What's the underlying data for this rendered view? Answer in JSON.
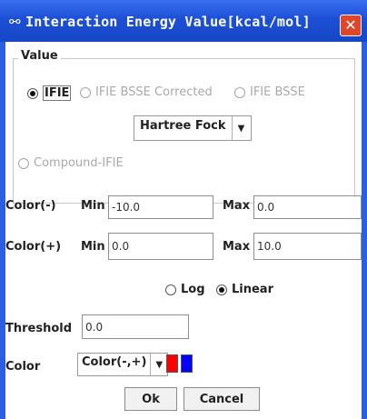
{
  "window": {
    "title": "Interaction Energy Value[kcal/mol]",
    "title_icon": "molecule-icon",
    "close_symbol": "✕"
  },
  "value_group": {
    "legend": "Value",
    "options": [
      {
        "label": "IFIE",
        "selected": true,
        "enabled": true
      },
      {
        "label": "IFIE BSSE Corrected",
        "selected": false,
        "enabled": false
      },
      {
        "label": "IFIE BSSE",
        "selected": false,
        "enabled": false
      }
    ],
    "method_select": {
      "value": "Hartree Fock",
      "arrow_symbol": "▼"
    },
    "compound_option": {
      "label": "Compound-IFIE",
      "selected": false,
      "enabled": false
    }
  },
  "color_minus": {
    "label": "Color(-)",
    "min_label": "Min",
    "min_value": "-10.0",
    "max_label": "Max",
    "max_value": "0.0"
  },
  "color_plus": {
    "label": "Color(+)",
    "min_label": "Min",
    "min_value": "0.0",
    "max_label": "Max",
    "max_value": "10.0"
  },
  "scale": {
    "options": [
      {
        "label": "Log",
        "selected": false
      },
      {
        "label": "Linear",
        "selected": true
      }
    ]
  },
  "threshold": {
    "label": "Threshold",
    "value": "0.0"
  },
  "color": {
    "label": "Color",
    "select_value": "Color(-,+)",
    "arrow_symbol": "▼",
    "swatches": [
      "#ff0000",
      "#0000ff"
    ]
  },
  "buttons": {
    "ok": "Ok",
    "cancel": "Cancel"
  }
}
